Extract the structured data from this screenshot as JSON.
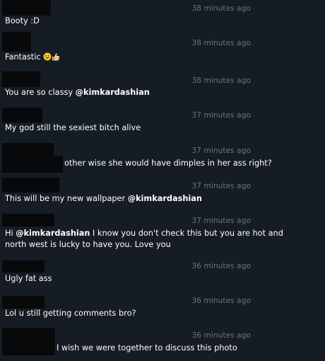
{
  "comments": [
    {
      "time": "38 minutes ago",
      "text": "Booty :D"
    },
    {
      "time": "38 minutes ago",
      "text": "Fantastic",
      "emojis": [
        "grinning-face-icon",
        "thumbs-up-icon"
      ]
    },
    {
      "time": "38 minutes ago",
      "text": "You are so classy ",
      "mention": "@kimkardashian"
    },
    {
      "time": "37 minutes ago",
      "text": "My god still the sexiest bitch alive"
    },
    {
      "time": "37 minutes ago",
      "text": "other wise she would have dimples in her ass right?"
    },
    {
      "time": "37 minutes ago",
      "text": "This will be my new wallpaper ",
      "mention": "@kimkardashian"
    },
    {
      "time": "37 minutes ago",
      "text_before": "Hi ",
      "mention": "@kimkardashian",
      "text_after": " I know you don't check this but you are hot and north west is lucky to have you. Love you"
    },
    {
      "time": "36 minutes ago",
      "text": "Ugly fat ass"
    },
    {
      "time": "36 minutes ago",
      "text": "Lol u still getting comments bro?"
    },
    {
      "time": "36 minutes ago",
      "text": "I wish we were together to discuss this photo"
    }
  ],
  "colors": {
    "background": "#151c23",
    "redaction": "#08090b",
    "timestamp": "#6e7479",
    "text": "#ffffff"
  }
}
